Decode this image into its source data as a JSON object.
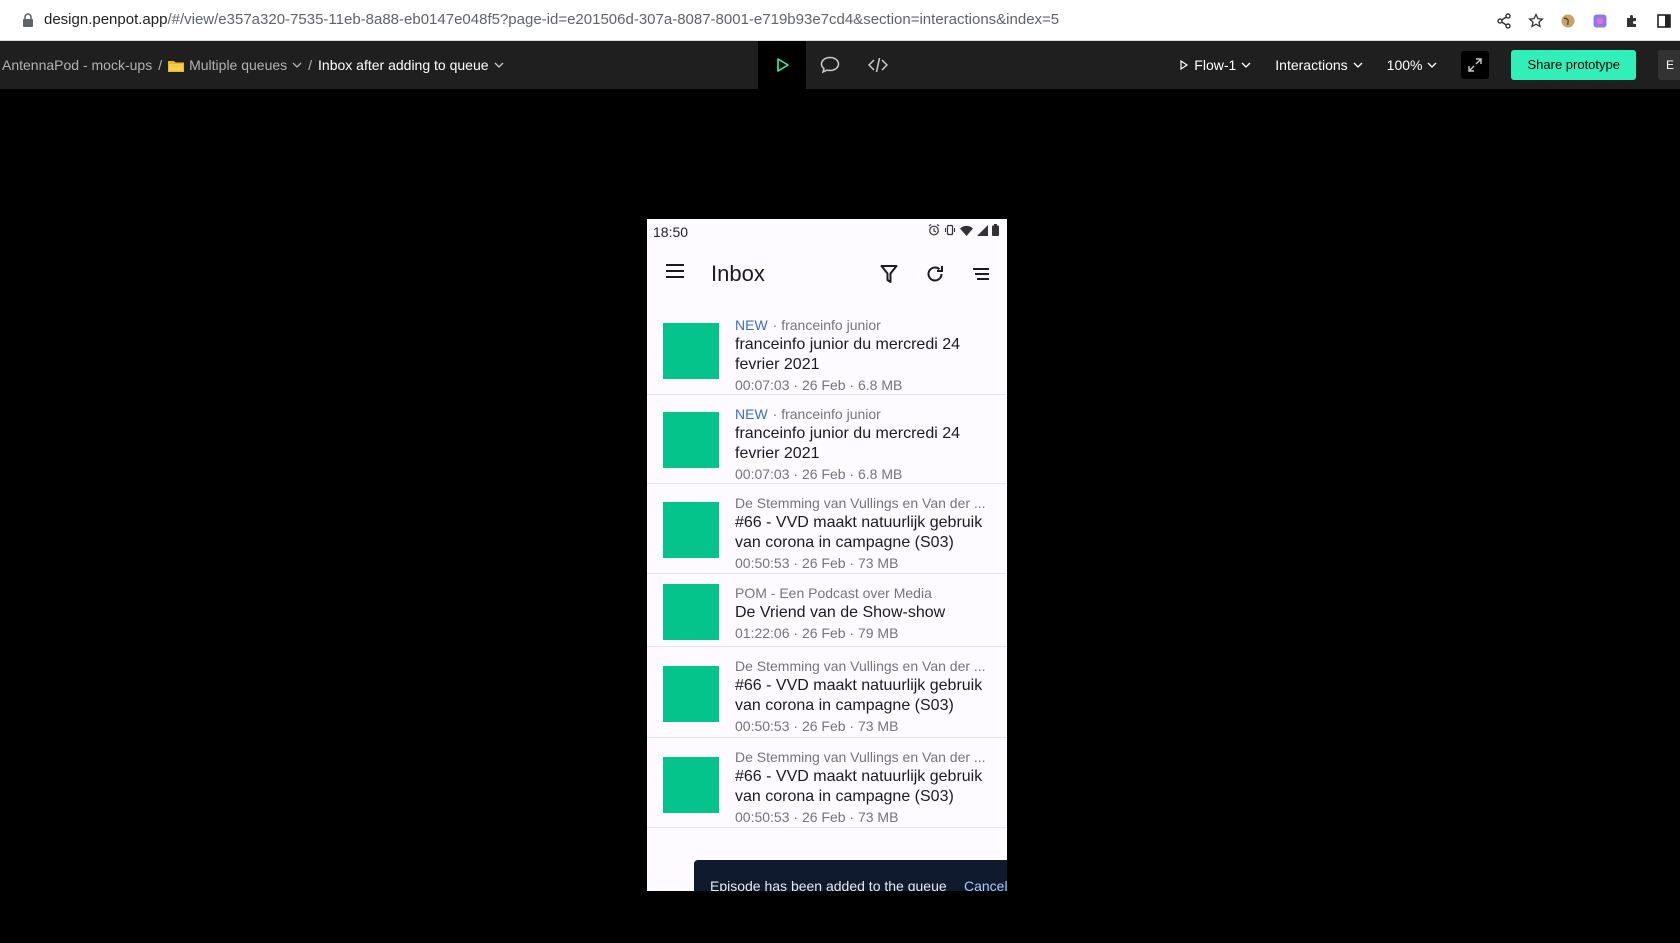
{
  "browser": {
    "url_host": "design.penpot.app",
    "url_path": "/#/view/e357a320-7535-11eb-8a88-eb0147e048f5?page-id=e201506d-307a-8087-8001-e719b93e7cd4&section=interactions&index=5"
  },
  "toolbar": {
    "project": "AntennaPod - mock-ups",
    "file": "Multiple queues",
    "page": "Inbox after adding to queue",
    "flow": "Flow-1",
    "interactions": "Interactions",
    "zoom": "100%",
    "share": "Share prototype",
    "edge": "E"
  },
  "phone": {
    "time": "18:50",
    "title": "Inbox",
    "items": [
      {
        "badge": "NEW",
        "podcast": "· franceinfo junior",
        "title_line1": "franceinfo junior du mercredi 24",
        "title_line2": "fevrier 2021",
        "info": "00:07:03 · 26 Feb · 6.8 MB"
      },
      {
        "badge": "NEW",
        "podcast": "· franceinfo junior",
        "title_line1": "franceinfo junior du mercredi 24",
        "title_line2": "fevrier 2021",
        "info": "00:07:03 · 26 Feb · 6.8 MB"
      },
      {
        "badge": "",
        "podcast": "De Stemming van Vullings en Van der ...",
        "title_line1": "#66 - VVD maakt natuurlijk gebruik",
        "title_line2": "van corona in campagne (S03)",
        "info": "00:50:53 · 26 Feb · 73 MB"
      },
      {
        "badge": "",
        "podcast": "POM - Een Podcast over Media",
        "title_line1": "De Vriend van de Show-show",
        "title_line2": "",
        "info": "01:22:06 · 26 Feb · 79 MB"
      },
      {
        "badge": "",
        "podcast": "De Stemming van Vullings en Van der ...",
        "title_line1": "#66 - VVD maakt natuurlijk gebruik",
        "title_line2": "van corona in campagne (S03)",
        "info": "00:50:53 · 26 Feb · 73 MB"
      },
      {
        "badge": "",
        "podcast": "De Stemming van Vullings en Van der ...",
        "title_line1": "#66 - VVD maakt natuurlijk gebruik",
        "title_line2": "van corona in campagne (S03)",
        "info": "00:50:53 · 26 Feb · 73 MB"
      }
    ],
    "snackbar": {
      "message": "Episode has been added to the queue",
      "action": "Cancel"
    }
  },
  "colors": {
    "accent": "#31efb8",
    "cover": "#05c48b",
    "new_badge": "#3a6ec8"
  }
}
